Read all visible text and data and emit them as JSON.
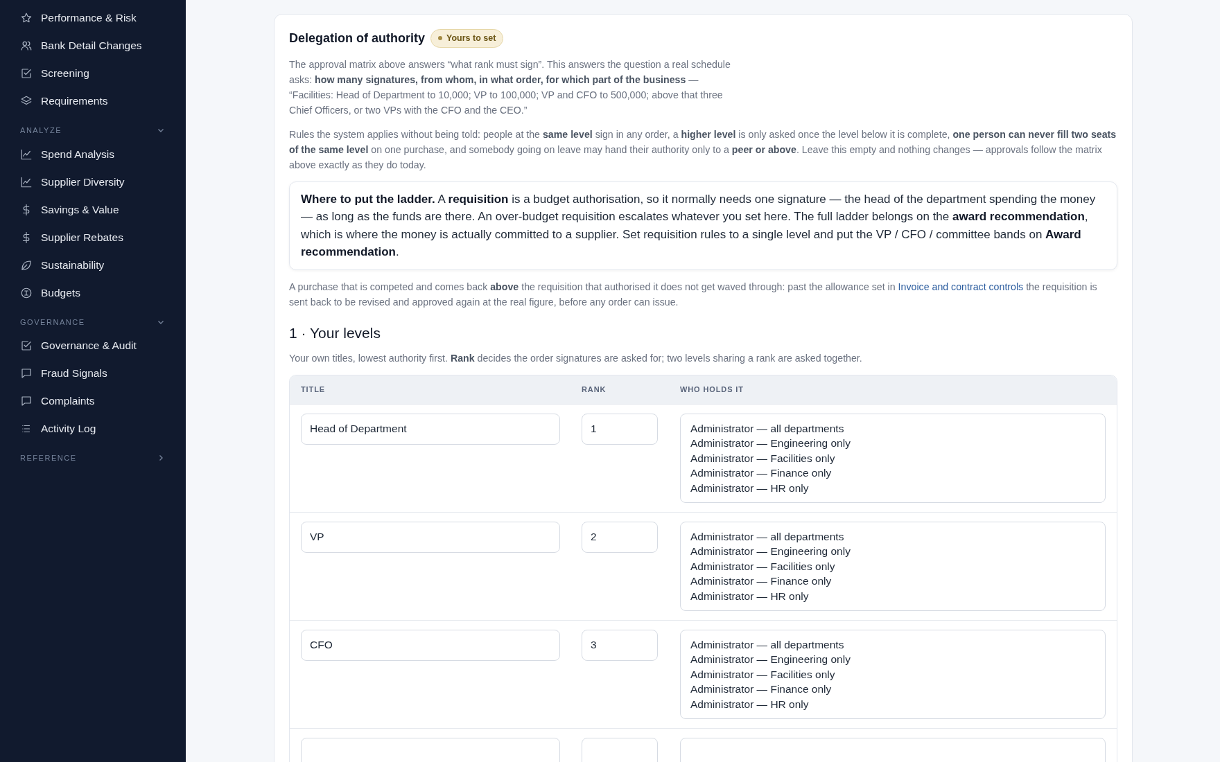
{
  "sidebar": {
    "sections": [
      {
        "items": [
          {
            "label": "Performance & Risk",
            "kind": "star"
          },
          {
            "label": "Bank Detail Changes",
            "kind": "users"
          },
          {
            "label": "Screening",
            "kind": "check"
          },
          {
            "label": "Requirements",
            "kind": "layers"
          }
        ]
      },
      {
        "heading": "ANALYZE",
        "expanded": true,
        "items": [
          {
            "label": "Spend Analysis",
            "kind": "chart"
          },
          {
            "label": "Supplier Diversity",
            "kind": "chart"
          },
          {
            "label": "Savings & Value",
            "kind": "dollar"
          },
          {
            "label": "Supplier Rebates",
            "kind": "dollar"
          },
          {
            "label": "Sustainability",
            "kind": "leaf"
          },
          {
            "label": "Budgets",
            "kind": "coin"
          }
        ]
      },
      {
        "heading": "GOVERNANCE",
        "expanded": true,
        "items": [
          {
            "label": "Governance & Audit",
            "kind": "check"
          },
          {
            "label": "Fraud Signals",
            "kind": "message"
          },
          {
            "label": "Complaints",
            "kind": "message"
          },
          {
            "label": "Activity Log",
            "kind": "list"
          }
        ]
      },
      {
        "heading": "REFERENCE",
        "expanded": false
      }
    ]
  },
  "card": {
    "title": "Delegation of authority",
    "badge": "Yours to set",
    "intro": "The approval matrix above answers “what rank must sign”. This answers the question a real schedule asks: **how many signatures, from whom, in what order, for which part of the business** — “Facilities: Head of Department to 10,000; VP to 100,000; VP and CFO to 500,000; above that three Chief Officers, or two VPs with the CFO and the CEO.”",
    "rules": "Rules the system applies without being told: people at the **same level** sign in any order, a **higher level** is only asked once the level below it is complete, **one person can never fill two seats of the same level** on one purchase, and somebody going on leave may hand their authority only to a **peer or above**. Leave this empty and nothing changes — approvals follow the matrix above exactly as they do today.",
    "callout": "**Where to put the ladder.** A **requisition** is a budget authorisation, so it normally needs one signature — the head of the department spending the money — as long as the funds are there. An over-budget requisition escalates whatever you set here. The full ladder belongs on the **award recommendation**, which is where the money is actually committed to a supplier. Set requisition rules to a single level and put the VP / CFO / committee bands on **Award recommendation**.",
    "note": {
      "before": "A purchase that is competed and comes back **above** the requisition that authorised it does not get waved through: past the allowance set in",
      "link": "Invoice and contract controls",
      "after": "the requisition is sent back to be revised and approved again at the real figure, before any order can issue."
    },
    "levels": {
      "heading": "1 · Your levels",
      "hint": "Your own titles, lowest authority first. **Rank** decides the order signatures are asked for; two levels sharing a rank are asked together.",
      "columns": [
        "TITLE",
        "RANK",
        "WHO HOLDS IT"
      ],
      "rows": [
        {
          "title": "Head of Department",
          "rank": "1",
          "holders": [
            "Administrator — all departments",
            "Administrator — Engineering only",
            "Administrator — Facilities only",
            "Administrator — Finance only",
            "Administrator — HR only"
          ]
        },
        {
          "title": "VP",
          "rank": "2",
          "holders": [
            "Administrator — all departments",
            "Administrator — Engineering only",
            "Administrator — Facilities only",
            "Administrator — Finance only",
            "Administrator — HR only"
          ]
        },
        {
          "title": "CFO",
          "rank": "3",
          "holders": [
            "Administrator — all departments",
            "Administrator — Engineering only",
            "Administrator — Facilities only",
            "Administrator — Finance only",
            "Administrator — HR only"
          ]
        },
        {}
      ]
    }
  }
}
